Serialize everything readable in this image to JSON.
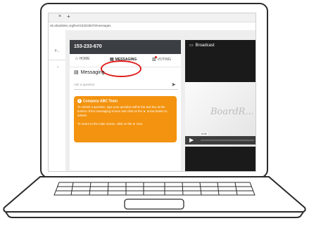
{
  "browser": {
    "tab_close": "×",
    "tab_new": "+",
    "url": "eb.ahaslides.org/live/153233670/messages"
  },
  "sidebar": {
    "item1": "F...",
    "item2": "⌄"
  },
  "panel": {
    "event_code": "153-233-670",
    "nav": [
      {
        "label": "HOME",
        "icon": "home-icon"
      },
      {
        "label": "MESSAGING",
        "icon": "chat-icon"
      },
      {
        "label": "VOTING",
        "icon": "voting-icon"
      }
    ],
    "messaging_title": "Messaging",
    "input_placeholder": "Ask a question",
    "note": {
      "title": "Company ABC Team",
      "body": "To submit a question, type your question within the text box at the bottom of the messaging screen and click on the ► arrow button to submit.",
      "body2": "To return to the main screen, click on the ► icon."
    }
  },
  "broadcast": {
    "title": "Broadcast",
    "video_logo": "BoardR...",
    "time": "0:00"
  },
  "colors": {
    "header_bg": "#3b3f44",
    "note_bg": "#f3930f",
    "highlight": "#e01a1a"
  }
}
